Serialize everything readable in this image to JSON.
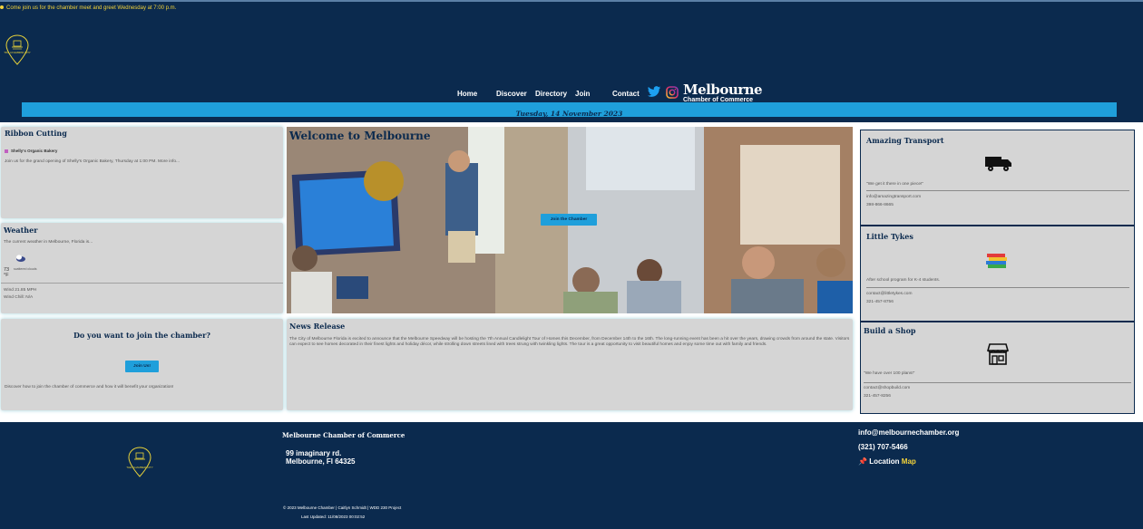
{
  "announcement": "Come join us for the chamber meet and greet Wednesday at 7:00 p.m.",
  "logo_text": "THE CHAMBER CITY",
  "nav": [
    "Home",
    "Discover",
    "Directory",
    "Join",
    "Contact"
  ],
  "brand": {
    "name": "Melbourne",
    "sub": "Chamber of Commerce"
  },
  "date": "Tuesday, 14 November 2023",
  "ribbon": {
    "title": "Ribbon Cutting",
    "business": "Shelly's Organic Bakery",
    "text": "Join us for the grand opening of Shelly's Organic Bakery, Thursday at 1:00 PM. More info..."
  },
  "weather": {
    "title": "Weather",
    "intro": "The current weather in Melbourne, Florida is...",
    "temp": "73",
    "unit": "°F",
    "desc": "scattered clouds",
    "wind": "Wind 21.85 MPH",
    "chill": "Wind Chill: N/A"
  },
  "welcome": {
    "title": "Welcome to Melbourne",
    "button": "Join the Chamber"
  },
  "join": {
    "question": "Do you want to join the chamber?",
    "button": "Join Us!",
    "text": "Discover how to join the chamber of commerce and how it will benefit your organization!"
  },
  "news": {
    "title": "News Release",
    "text": "The City of Melbourne Florida is excited to announce that the Melbourne Speedway will be hosting the 7th Annual Candlelight Tour of Homes this December, from December 14th to the 16th. The long-running event has been a hit over the years, drawing crowds from around the state. Visitors can expect to see homes decorated in their finest lights and holiday décor, while strolling down streets lined with trees strung with twinkling lights. The tour is a great opportunity to visit beautiful homes and enjoy some time out with family and friends."
  },
  "spotlights": [
    {
      "name": "Amazing Transport",
      "tagline": "\"We get it there in one piece!\"",
      "email": "info@amazingtransport.com",
      "phone": "398-866-8665",
      "icon": "truck-icon"
    },
    {
      "name": "Little Tykes",
      "tagline": "After school program for K-4 students.",
      "email": "contact@littletykes.com",
      "phone": "321-457-8756",
      "icon": "books-icon"
    },
    {
      "name": "Build a Shop",
      "tagline": "\"We have over 100 plans!\"",
      "email": "contact@shopbuild.com",
      "phone": "321-457-8256",
      "icon": "shop-icon"
    }
  ],
  "footer": {
    "org": "Melbourne Chamber of Commerce",
    "address1": "99 imaginary rd.",
    "address2": "Melbourne, Fl 64325",
    "email": "info@melbournechamber.org",
    "phone": "(321) 707-5466",
    "location_label": "Location",
    "map_label": "Map",
    "copyright": "© 2023 Melbourne Chamber | Caitlyn Schmidt | WDD 230 Project",
    "updated": "Last Updated: 11/08/2023 00:02:52"
  },
  "colors": {
    "navy": "#0b2a4e",
    "accent": "#1f9fdb",
    "panel": "#d5d5d5",
    "gold": "#f2d23a"
  }
}
